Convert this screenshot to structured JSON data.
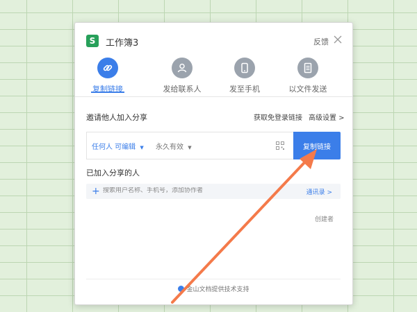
{
  "dialog": {
    "logo_letter": "S",
    "title": "工作簿3",
    "feedback": "反馈",
    "close_icon": "close-icon"
  },
  "tabs": [
    {
      "label": "复制链接",
      "icon": "link-icon",
      "active": true
    },
    {
      "label": "发给联系人",
      "icon": "person-icon",
      "active": false
    },
    {
      "label": "发至手机",
      "icon": "phone-icon",
      "active": false
    },
    {
      "label": "以文件发送",
      "icon": "file-icon",
      "active": false
    }
  ],
  "invite": {
    "label": "邀请他人加入分享",
    "free_login_link": "获取免登录链接",
    "advanced_settings": "高级设置 >"
  },
  "link": {
    "permission": "任何人 可编辑",
    "expiry": "永久有效",
    "copy_button": "复制链接",
    "qr_icon": "qr-code-icon"
  },
  "joined": {
    "label": "已加入分享的人",
    "search_placeholder": "搜索用户名称、手机号，添加协作者",
    "contacts": "通讯录 >",
    "creator_badge": "创建者"
  },
  "footer": {
    "text": "金山文档提供技术支持"
  },
  "colors": {
    "accent": "#3b7ee9",
    "app_green": "#27a05a",
    "arrow": "#f47a4a"
  }
}
